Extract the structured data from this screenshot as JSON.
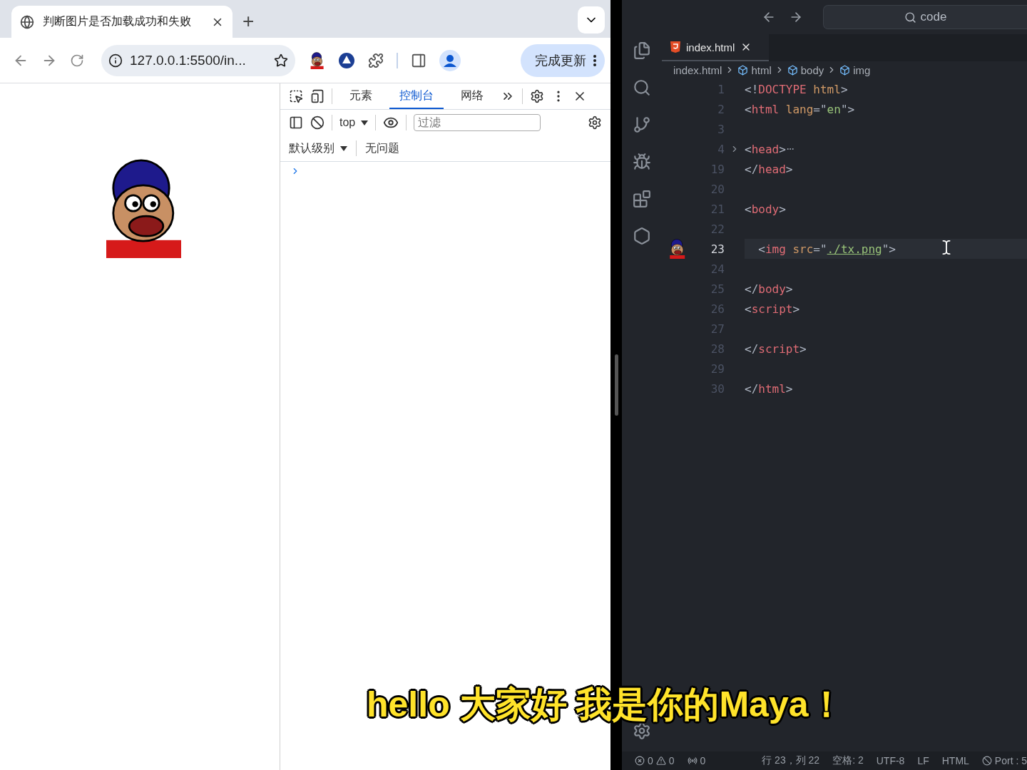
{
  "browser": {
    "tab": {
      "title": "判断图片是否加载成功和失败",
      "selected": true
    },
    "new_tab": "+",
    "address": "127.0.0.1:5500/in...",
    "update_button": "完成更新",
    "devtools": {
      "tabs": [
        {
          "label": "元素",
          "selected": false
        },
        {
          "label": "控制台",
          "selected": true
        },
        {
          "label": "网络",
          "selected": false
        }
      ],
      "context": "top",
      "filter_placeholder": "过滤",
      "level": "默认级别",
      "issues": "无问题"
    }
  },
  "editor": {
    "search": "code",
    "tab": {
      "label": "index.html",
      "selected": true
    },
    "breadcrumbs": [
      "index.html",
      "html",
      "body",
      "img"
    ],
    "lines": [
      {
        "number": "1",
        "current": false,
        "folded": false,
        "avatar": false,
        "tokens": [
          {
            "kind": "punct",
            "text": "<!"
          },
          {
            "kind": "tag",
            "text": "DOCTYPE"
          },
          {
            "kind": "attr",
            "text": " html"
          },
          {
            "kind": "punct",
            "text": ">"
          }
        ]
      },
      {
        "number": "2",
        "current": false,
        "folded": false,
        "avatar": false,
        "tokens": [
          {
            "kind": "punct",
            "text": "<"
          },
          {
            "kind": "tag",
            "text": "html"
          },
          {
            "kind": "attr",
            "text": " lang"
          },
          {
            "kind": "punct",
            "text": "=\""
          },
          {
            "kind": "string",
            "text": "en"
          },
          {
            "kind": "punct",
            "text": "\">"
          }
        ]
      },
      {
        "number": "3",
        "current": false,
        "folded": false,
        "avatar": false
      },
      {
        "number": "4",
        "current": false,
        "folded": true,
        "avatar": false,
        "tokens": [
          {
            "kind": "punct",
            "text": "<"
          },
          {
            "kind": "tag",
            "text": "head"
          },
          {
            "kind": "punct",
            "text": ">"
          }
        ]
      },
      {
        "number": "19",
        "current": false,
        "folded": false,
        "avatar": false,
        "tokens": [
          {
            "kind": "punct",
            "text": "</"
          },
          {
            "kind": "tag",
            "text": "head"
          },
          {
            "kind": "punct",
            "text": ">"
          }
        ]
      },
      {
        "number": "20",
        "current": false,
        "folded": false,
        "avatar": false
      },
      {
        "number": "21",
        "current": false,
        "folded": false,
        "avatar": false,
        "tokens": [
          {
            "kind": "punct",
            "text": "<"
          },
          {
            "kind": "tag",
            "text": "body"
          },
          {
            "kind": "punct",
            "text": ">"
          }
        ]
      },
      {
        "number": "22",
        "current": false,
        "folded": false,
        "avatar": false
      },
      {
        "number": "23",
        "current": true,
        "folded": false,
        "avatar": true,
        "tokens": [
          {
            "kind": "punct",
            "text": "  <"
          },
          {
            "kind": "tag",
            "text": "img"
          },
          {
            "kind": "attr",
            "text": " src"
          },
          {
            "kind": "punct",
            "text": "=\""
          },
          {
            "kind": "link",
            "text": "./tx.png"
          },
          {
            "kind": "punct",
            "text": "\">"
          }
        ]
      },
      {
        "number": "24",
        "current": false,
        "folded": false,
        "avatar": false
      },
      {
        "number": "25",
        "current": false,
        "folded": false,
        "avatar": false,
        "tokens": [
          {
            "kind": "punct",
            "text": "</"
          },
          {
            "kind": "tag",
            "text": "body"
          },
          {
            "kind": "punct",
            "text": ">"
          }
        ]
      },
      {
        "number": "26",
        "current": false,
        "folded": false,
        "avatar": false,
        "tokens": [
          {
            "kind": "punct",
            "text": "<"
          },
          {
            "kind": "tag",
            "text": "script"
          },
          {
            "kind": "punct",
            "text": ">"
          }
        ]
      },
      {
        "number": "27",
        "current": false,
        "folded": false,
        "avatar": false
      },
      {
        "number": "28",
        "current": false,
        "folded": false,
        "avatar": false,
        "tokens": [
          {
            "kind": "punct",
            "text": "</"
          },
          {
            "kind": "tag",
            "text": "script"
          },
          {
            "kind": "punct",
            "text": ">"
          }
        ]
      },
      {
        "number": "29",
        "current": false,
        "folded": false,
        "avatar": false
      },
      {
        "number": "30",
        "current": false,
        "folded": false,
        "avatar": false,
        "tokens": [
          {
            "kind": "punct",
            "text": "</"
          },
          {
            "kind": "tag",
            "text": "html"
          },
          {
            "kind": "punct",
            "text": ">"
          }
        ]
      }
    ],
    "status": {
      "errors": "0",
      "warnings": "0",
      "ports": "0",
      "position": "行 23，列 22",
      "spaces": "空格: 2",
      "encoding": "UTF-8",
      "eol": "LF",
      "language": "HTML",
      "port": "Port : 5"
    }
  },
  "subtitle": "hello 大家好 我是你的Maya！"
}
